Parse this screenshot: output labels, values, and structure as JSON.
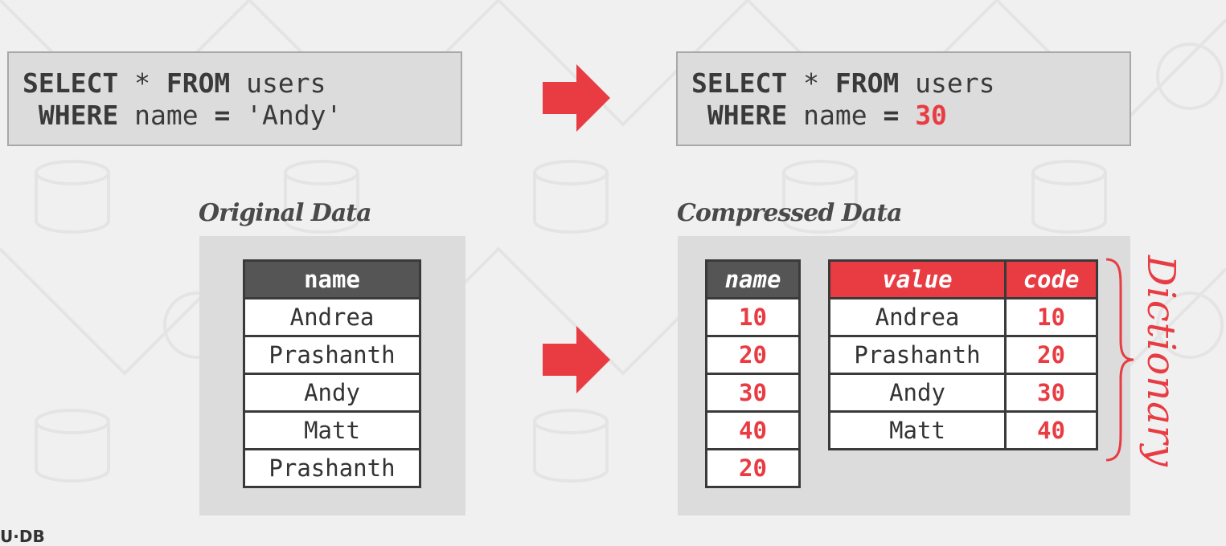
{
  "query_original": {
    "line1": {
      "kw1": "SELECT",
      "op": " * ",
      "kw2": "FROM",
      "rest": " users"
    },
    "line2": {
      "kw": " WHERE",
      "mid": " name ",
      "op": "=",
      "val": " 'Andy'"
    }
  },
  "query_compressed": {
    "line1": {
      "kw1": "SELECT",
      "op": " * ",
      "kw2": "FROM",
      "rest": " users"
    },
    "line2": {
      "kw": " WHERE",
      "mid": " name ",
      "op": "=",
      "val": "30"
    }
  },
  "original": {
    "heading": "Original Data",
    "header": "name",
    "rows": [
      "Andrea",
      "Prashanth",
      "Andy",
      "Matt",
      "Prashanth"
    ]
  },
  "compressed": {
    "heading": "Compressed Data",
    "column_header": "name",
    "column_values": [
      "10",
      "20",
      "30",
      "40",
      "20"
    ],
    "dictionary_headers": {
      "value": "value",
      "code": "code"
    },
    "dictionary_rows": [
      {
        "value": "Andrea",
        "code": "10"
      },
      {
        "value": "Prashanth",
        "code": "20"
      },
      {
        "value": "Andy",
        "code": "30"
      },
      {
        "value": "Matt",
        "code": "40"
      }
    ],
    "dictionary_label": "Dictionary"
  },
  "footer_logo": "U·DB",
  "colors": {
    "accent": "#e83c42",
    "header_dark": "#555555",
    "panel": "#dcdcdc"
  }
}
